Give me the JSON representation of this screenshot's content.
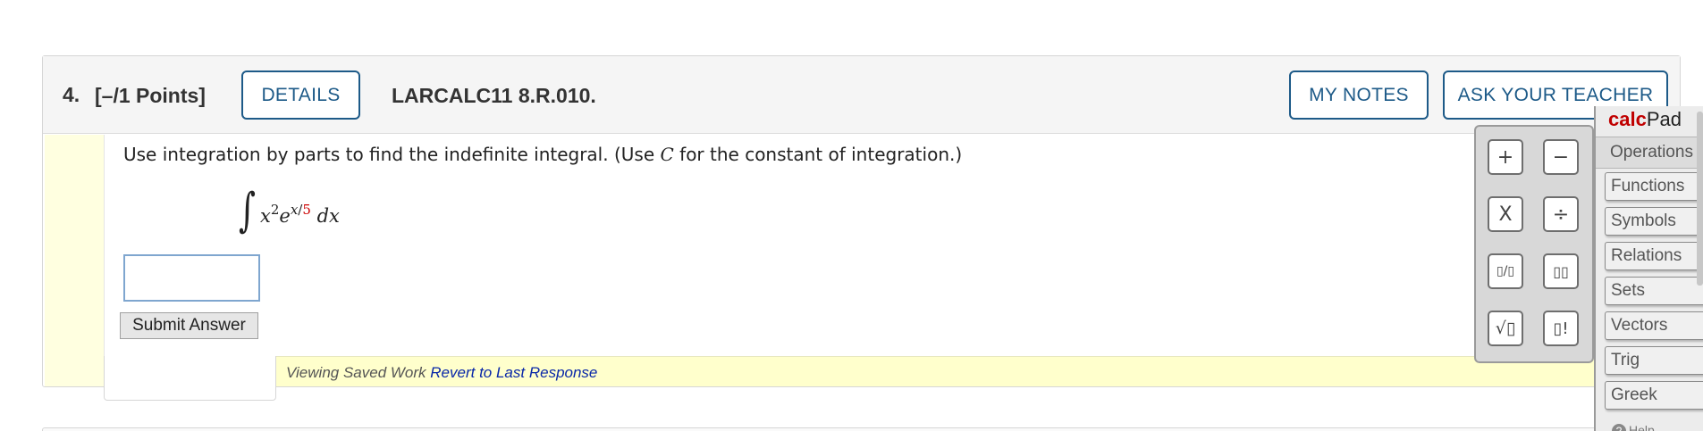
{
  "question": {
    "number": "4.",
    "points": "[–/1 Points]",
    "details_label": "DETAILS",
    "code": "LARCALC11 8.R.010.",
    "my_notes_label": "MY NOTES",
    "ask_teacher_label": "ASK YOUR TEACHER",
    "instruction_pre": "Use integration by parts to find the indefinite integral. (Use ",
    "instruction_var": "C",
    "instruction_post": " for the constant of integration.)",
    "integral": {
      "sign": "∫",
      "base": "x",
      "base_exp": "2",
      "e": "e",
      "exp_var": "x",
      "exp_slash": "/",
      "exp_denominator": "5",
      "dx": "dx"
    },
    "answer_value": "",
    "submit_label": "Submit Answer",
    "saved_text": "Viewing Saved Work",
    "revert_label": "Revert to Last Response"
  },
  "calcpad": {
    "title_part1": "calc",
    "title_part2": "Pad",
    "active_tab": "Operations",
    "keys": [
      "+",
      "−",
      "X",
      "÷",
      "▯/▯",
      "▯▯",
      "√▯",
      "▯!"
    ],
    "menu_items": [
      "Functions",
      "Symbols",
      "Relations",
      "Sets",
      "Vectors",
      "Trig",
      "Greek"
    ],
    "help_label": "Help"
  },
  "colors": {
    "accent_blue": "#1d5a88",
    "calc_red": "#c00000",
    "footer_yellow": "#ffffcc",
    "link_blue": "#0a28a8"
  }
}
